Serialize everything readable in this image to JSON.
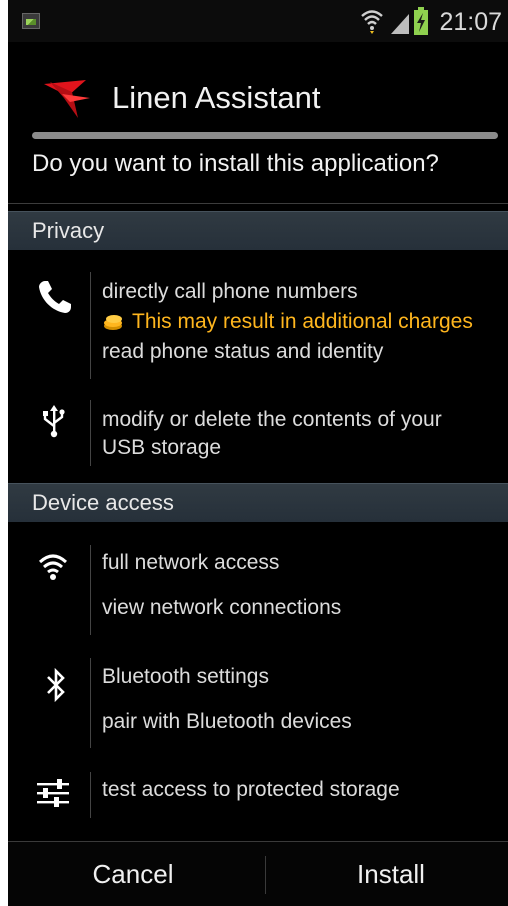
{
  "status_bar": {
    "time": "21:07",
    "icons": [
      "notification-image-icon",
      "wifi-icon",
      "signal-icon",
      "battery-charging-icon"
    ]
  },
  "installer": {
    "app_name": "Linen Assistant",
    "question": "Do you want to install this application?"
  },
  "sections": {
    "privacy": {
      "title": "Privacy",
      "groups": [
        {
          "icon": "phone-icon",
          "items": [
            "directly call phone numbers",
            "read phone status and identity"
          ],
          "warning": "This may result in additional charges"
        },
        {
          "icon": "usb-icon",
          "items": [
            "modify or delete the contents of your",
            "USB storage"
          ]
        }
      ]
    },
    "device_access": {
      "title": "Device access",
      "groups": [
        {
          "icon": "wifi-icon",
          "items": [
            "full network access",
            "view network connections"
          ]
        },
        {
          "icon": "bluetooth-icon",
          "items": [
            "Bluetooth settings",
            "pair with Bluetooth devices"
          ]
        },
        {
          "icon": "sliders-icon",
          "items": [
            "test access to protected storage"
          ]
        }
      ]
    }
  },
  "buttons": {
    "cancel": "Cancel",
    "install": "Install"
  },
  "colors": {
    "background": "#000000",
    "section_header": "#2b353e",
    "warning": "#ffb61e",
    "app_icon": "#e0141c"
  }
}
